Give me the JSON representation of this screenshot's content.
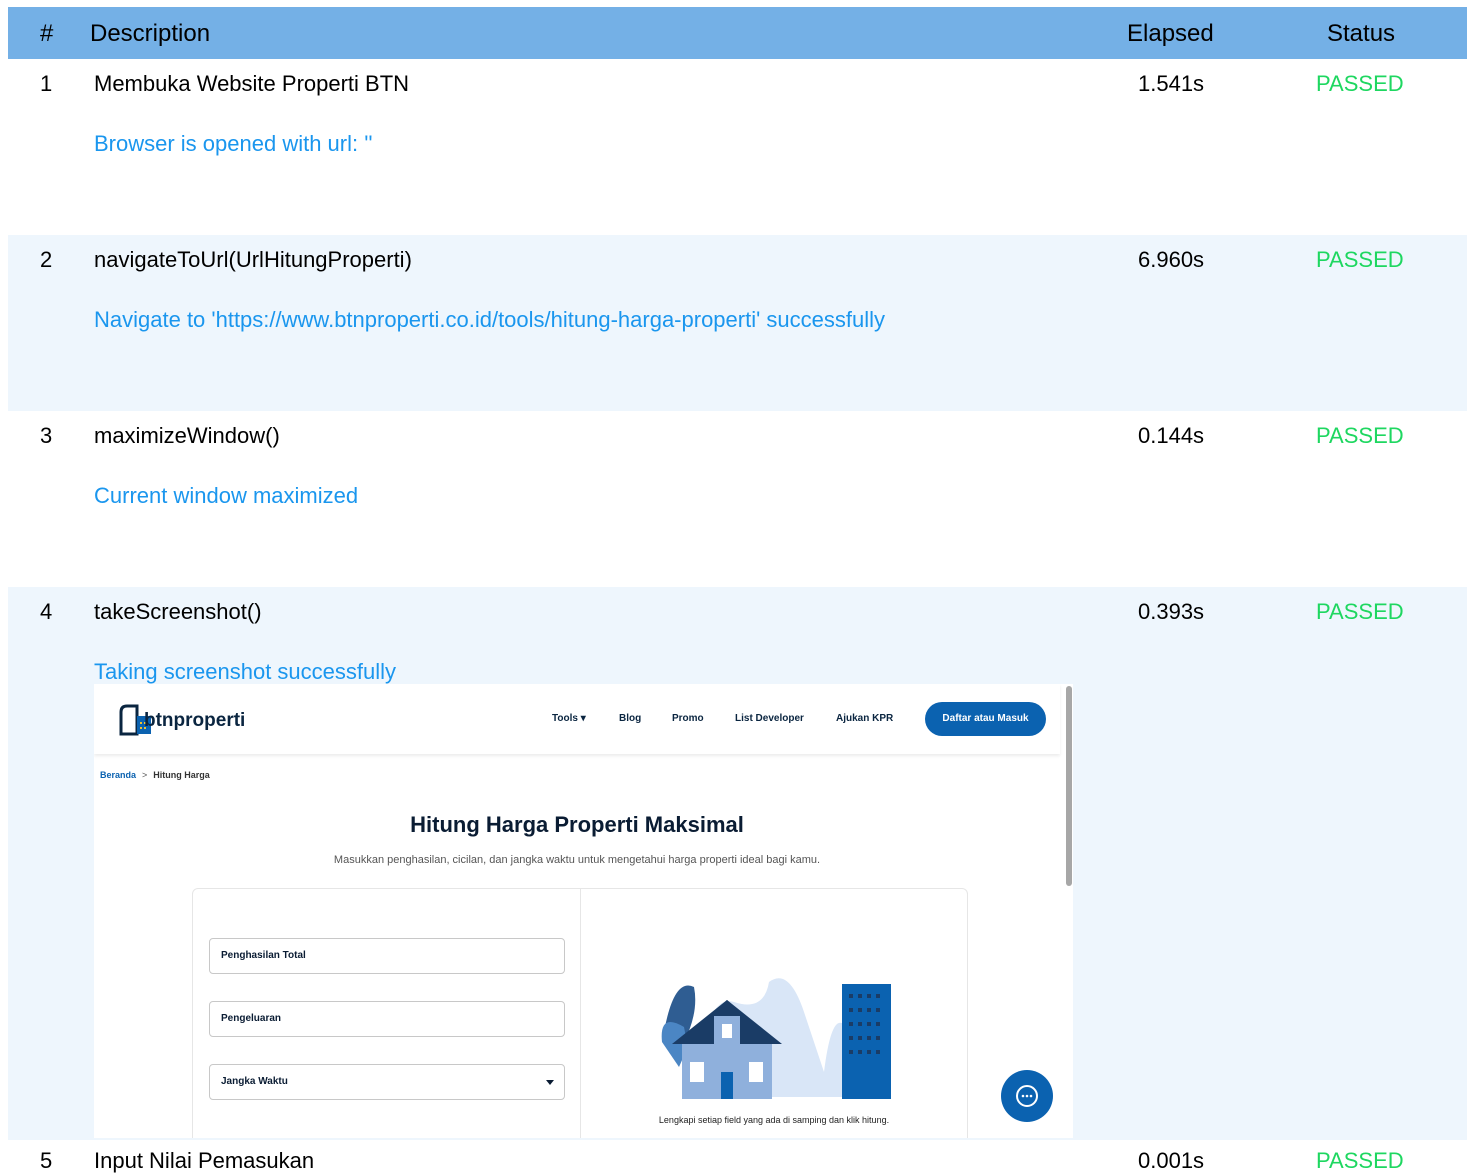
{
  "header": {
    "num": "#",
    "description": "Description",
    "elapsed": "Elapsed",
    "status": "Status"
  },
  "steps": [
    {
      "num": "1",
      "description": "Membuka Website Properti BTN",
      "elapsed": "1.541s",
      "status": "PASSED",
      "message": "Browser is opened with url: ''"
    },
    {
      "num": "2",
      "description": "navigateToUrl(UrlHitungProperti)",
      "elapsed": "6.960s",
      "status": "PASSED",
      "message": "Navigate to 'https://www.btnproperti.co.id/tools/hitung-harga-properti' successfully"
    },
    {
      "num": "3",
      "description": "maximizeWindow()",
      "elapsed": "0.144s",
      "status": "PASSED",
      "message": "Current window maximized"
    },
    {
      "num": "4",
      "description": "takeScreenshot()",
      "elapsed": "0.393s",
      "status": "PASSED",
      "message": "Taking screenshot successfully"
    },
    {
      "num": "5",
      "description": "Input Nilai Pemasukan",
      "elapsed": "0.001s",
      "status": "PASSED"
    }
  ],
  "colors": {
    "header_bg": "#74b0e6",
    "alt_row_bg": "#eef6fd",
    "passed": "#1ed760",
    "message": "#1a96ee",
    "brand": "#0b62b0"
  },
  "screenshot": {
    "logo_text": "btnproperti",
    "nav": {
      "tools": "Tools",
      "blog": "Blog",
      "promo": "Promo",
      "list_developer": "List Developer",
      "ajukan_kpr": "Ajukan KPR",
      "login": "Daftar atau Masuk"
    },
    "breadcrumb": {
      "home": "Beranda",
      "separator": ">",
      "current": "Hitung Harga"
    },
    "title": "Hitung Harga Properti Maksimal",
    "subtitle": "Masukkan penghasilan, cicilan, dan jangka waktu untuk mengetahui harga properti ideal bagi kamu.",
    "fields": {
      "income": "Penghasilan Total",
      "expense": "Pengeluaran",
      "term": "Jangka Waktu"
    },
    "illustration_caption": "Lengkapi setiap field yang ada di samping dan klik hitung."
  }
}
